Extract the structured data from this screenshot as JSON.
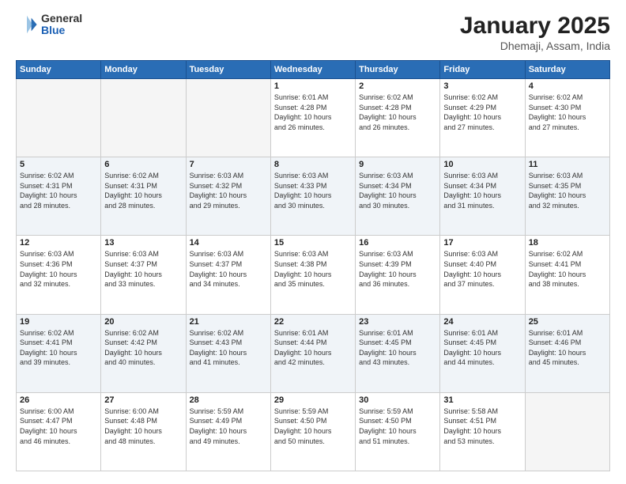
{
  "header": {
    "logo_general": "General",
    "logo_blue": "Blue",
    "month_title": "January 2025",
    "location": "Dhemaji, Assam, India"
  },
  "weekdays": [
    "Sunday",
    "Monday",
    "Tuesday",
    "Wednesday",
    "Thursday",
    "Friday",
    "Saturday"
  ],
  "weeks": [
    [
      {
        "day": "",
        "info": ""
      },
      {
        "day": "",
        "info": ""
      },
      {
        "day": "",
        "info": ""
      },
      {
        "day": "1",
        "info": "Sunrise: 6:01 AM\nSunset: 4:28 PM\nDaylight: 10 hours\nand 26 minutes."
      },
      {
        "day": "2",
        "info": "Sunrise: 6:02 AM\nSunset: 4:28 PM\nDaylight: 10 hours\nand 26 minutes."
      },
      {
        "day": "3",
        "info": "Sunrise: 6:02 AM\nSunset: 4:29 PM\nDaylight: 10 hours\nand 27 minutes."
      },
      {
        "day": "4",
        "info": "Sunrise: 6:02 AM\nSunset: 4:30 PM\nDaylight: 10 hours\nand 27 minutes."
      }
    ],
    [
      {
        "day": "5",
        "info": "Sunrise: 6:02 AM\nSunset: 4:31 PM\nDaylight: 10 hours\nand 28 minutes."
      },
      {
        "day": "6",
        "info": "Sunrise: 6:02 AM\nSunset: 4:31 PM\nDaylight: 10 hours\nand 28 minutes."
      },
      {
        "day": "7",
        "info": "Sunrise: 6:03 AM\nSunset: 4:32 PM\nDaylight: 10 hours\nand 29 minutes."
      },
      {
        "day": "8",
        "info": "Sunrise: 6:03 AM\nSunset: 4:33 PM\nDaylight: 10 hours\nand 30 minutes."
      },
      {
        "day": "9",
        "info": "Sunrise: 6:03 AM\nSunset: 4:34 PM\nDaylight: 10 hours\nand 30 minutes."
      },
      {
        "day": "10",
        "info": "Sunrise: 6:03 AM\nSunset: 4:34 PM\nDaylight: 10 hours\nand 31 minutes."
      },
      {
        "day": "11",
        "info": "Sunrise: 6:03 AM\nSunset: 4:35 PM\nDaylight: 10 hours\nand 32 minutes."
      }
    ],
    [
      {
        "day": "12",
        "info": "Sunrise: 6:03 AM\nSunset: 4:36 PM\nDaylight: 10 hours\nand 32 minutes."
      },
      {
        "day": "13",
        "info": "Sunrise: 6:03 AM\nSunset: 4:37 PM\nDaylight: 10 hours\nand 33 minutes."
      },
      {
        "day": "14",
        "info": "Sunrise: 6:03 AM\nSunset: 4:37 PM\nDaylight: 10 hours\nand 34 minutes."
      },
      {
        "day": "15",
        "info": "Sunrise: 6:03 AM\nSunset: 4:38 PM\nDaylight: 10 hours\nand 35 minutes."
      },
      {
        "day": "16",
        "info": "Sunrise: 6:03 AM\nSunset: 4:39 PM\nDaylight: 10 hours\nand 36 minutes."
      },
      {
        "day": "17",
        "info": "Sunrise: 6:03 AM\nSunset: 4:40 PM\nDaylight: 10 hours\nand 37 minutes."
      },
      {
        "day": "18",
        "info": "Sunrise: 6:02 AM\nSunset: 4:41 PM\nDaylight: 10 hours\nand 38 minutes."
      }
    ],
    [
      {
        "day": "19",
        "info": "Sunrise: 6:02 AM\nSunset: 4:41 PM\nDaylight: 10 hours\nand 39 minutes."
      },
      {
        "day": "20",
        "info": "Sunrise: 6:02 AM\nSunset: 4:42 PM\nDaylight: 10 hours\nand 40 minutes."
      },
      {
        "day": "21",
        "info": "Sunrise: 6:02 AM\nSunset: 4:43 PM\nDaylight: 10 hours\nand 41 minutes."
      },
      {
        "day": "22",
        "info": "Sunrise: 6:01 AM\nSunset: 4:44 PM\nDaylight: 10 hours\nand 42 minutes."
      },
      {
        "day": "23",
        "info": "Sunrise: 6:01 AM\nSunset: 4:45 PM\nDaylight: 10 hours\nand 43 minutes."
      },
      {
        "day": "24",
        "info": "Sunrise: 6:01 AM\nSunset: 4:45 PM\nDaylight: 10 hours\nand 44 minutes."
      },
      {
        "day": "25",
        "info": "Sunrise: 6:01 AM\nSunset: 4:46 PM\nDaylight: 10 hours\nand 45 minutes."
      }
    ],
    [
      {
        "day": "26",
        "info": "Sunrise: 6:00 AM\nSunset: 4:47 PM\nDaylight: 10 hours\nand 46 minutes."
      },
      {
        "day": "27",
        "info": "Sunrise: 6:00 AM\nSunset: 4:48 PM\nDaylight: 10 hours\nand 48 minutes."
      },
      {
        "day": "28",
        "info": "Sunrise: 5:59 AM\nSunset: 4:49 PM\nDaylight: 10 hours\nand 49 minutes."
      },
      {
        "day": "29",
        "info": "Sunrise: 5:59 AM\nSunset: 4:50 PM\nDaylight: 10 hours\nand 50 minutes."
      },
      {
        "day": "30",
        "info": "Sunrise: 5:59 AM\nSunset: 4:50 PM\nDaylight: 10 hours\nand 51 minutes."
      },
      {
        "day": "31",
        "info": "Sunrise: 5:58 AM\nSunset: 4:51 PM\nDaylight: 10 hours\nand 53 minutes."
      },
      {
        "day": "",
        "info": ""
      }
    ]
  ]
}
